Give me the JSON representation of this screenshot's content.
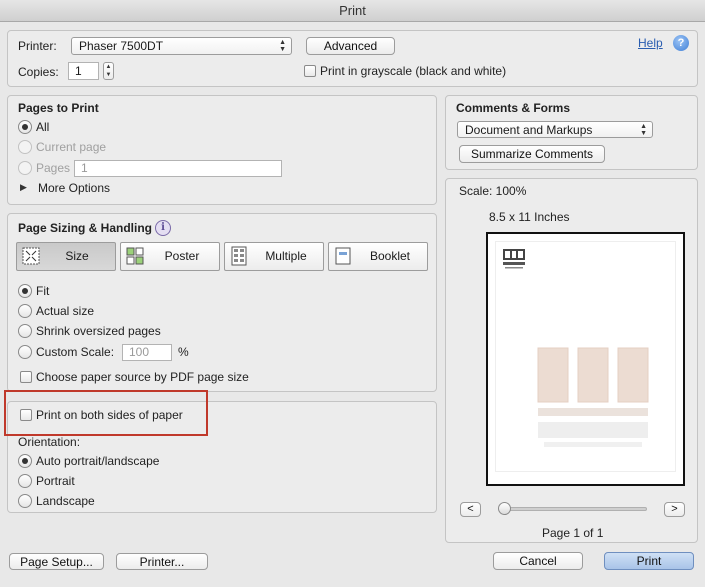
{
  "window": {
    "title": "Print"
  },
  "printer": {
    "label": "Printer:",
    "selected": "Phaser 7500DT",
    "advanced_button": "Advanced",
    "help_link": "Help",
    "copies_label": "Copies:",
    "copies_value": "1",
    "grayscale_label": "Print in grayscale (black and white)"
  },
  "pages_to_print": {
    "title": "Pages to Print",
    "all": "All",
    "current_page": "Current page",
    "pages": "Pages",
    "pages_value": "1",
    "more_options": "More Options"
  },
  "sizing": {
    "title": "Page Sizing & Handling",
    "tabs": {
      "size": "Size",
      "poster": "Poster",
      "multiple": "Multiple",
      "booklet": "Booklet"
    },
    "fit": "Fit",
    "actual_size": "Actual size",
    "shrink": "Shrink oversized pages",
    "custom_scale": "Custom Scale:",
    "custom_scale_value": "100",
    "percent": "%",
    "paper_source": "Choose paper source by PDF page size"
  },
  "duplex": {
    "label": "Print on both sides of paper",
    "highlight_color": "#c0392b"
  },
  "orientation": {
    "title": "Orientation:",
    "auto": "Auto portrait/landscape",
    "portrait": "Portrait",
    "landscape": "Landscape"
  },
  "comments": {
    "title": "Comments & Forms",
    "selected": "Document and Markups",
    "summarize_button": "Summarize Comments"
  },
  "preview": {
    "scale": "Scale: 100%",
    "paper_size": "8.5 x 11 Inches",
    "prev_button": "<",
    "next_button": ">",
    "page_info": "Page 1 of 1",
    "slider_position": 0
  },
  "footer": {
    "page_setup": "Page Setup...",
    "printer": "Printer...",
    "cancel": "Cancel",
    "print": "Print"
  }
}
